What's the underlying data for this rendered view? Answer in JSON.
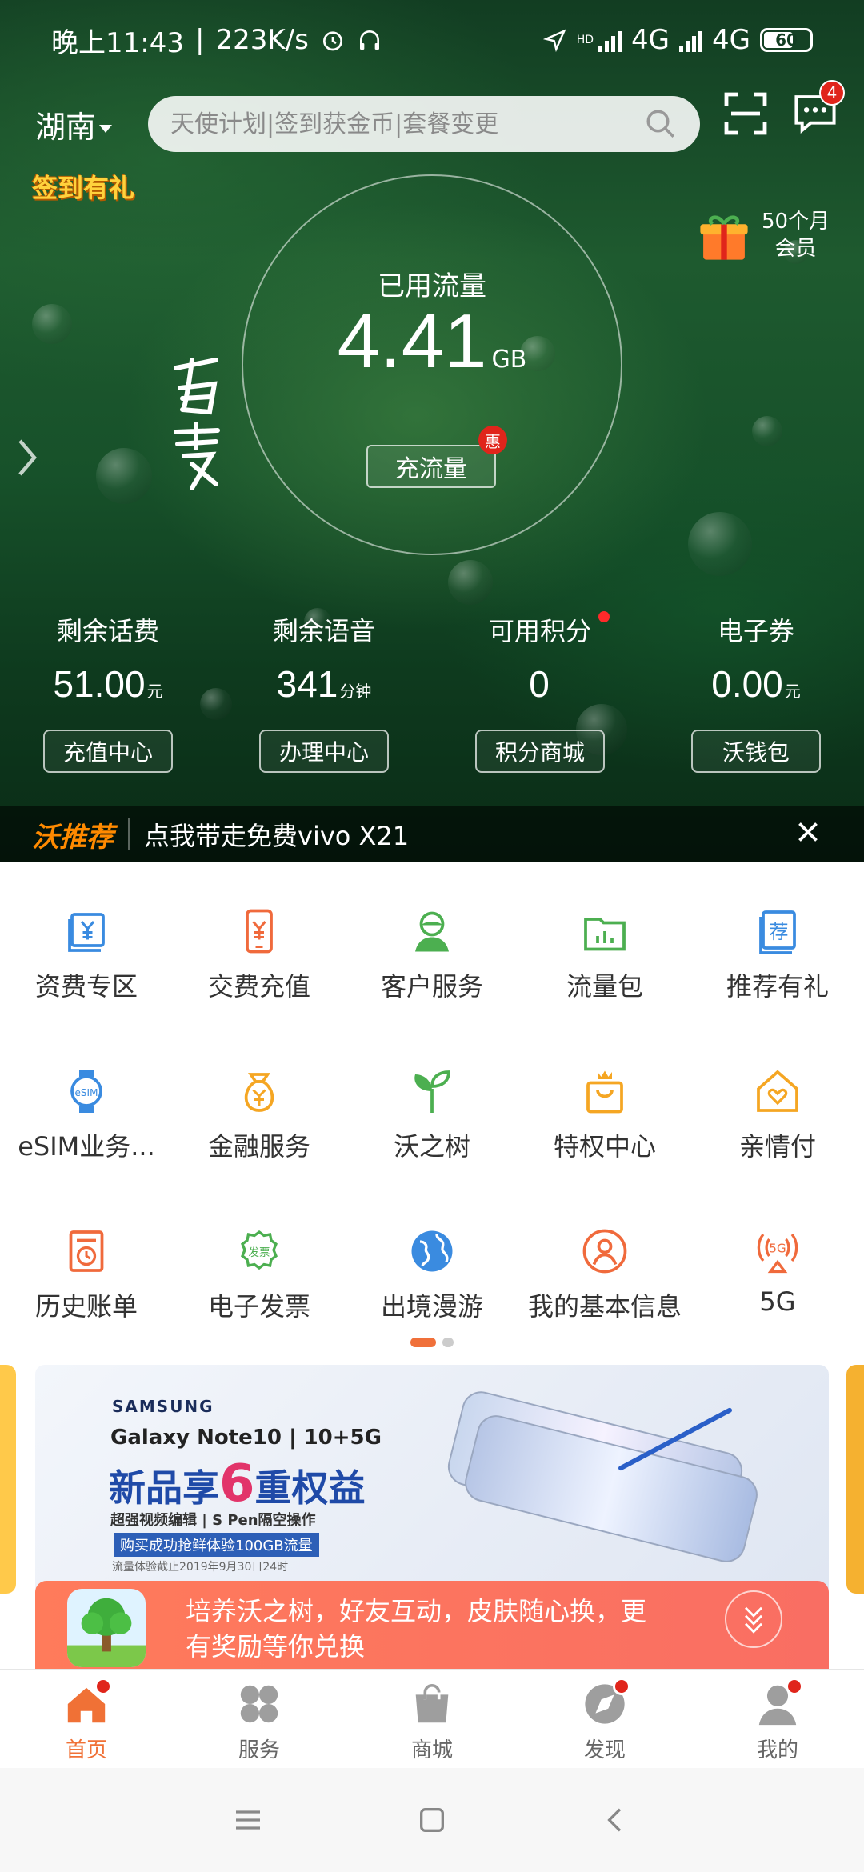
{
  "status_bar": {
    "time": "晚上11:43",
    "speed": "223K/s",
    "network1": "4G",
    "network2": "4G",
    "battery": "60",
    "hd": "HD"
  },
  "header": {
    "region": "湖南",
    "search_placeholder": "天使计划|签到获金币|套餐变更",
    "message_badge": "4"
  },
  "promo_badges": {
    "checkin": "签到有礼",
    "member_line1": "50个月",
    "member_line2": "会员"
  },
  "usage": {
    "label": "已用流量",
    "value": "4.41",
    "unit": "GB",
    "recharge_button": "充流量",
    "hui_badge": "惠"
  },
  "stats": [
    {
      "label": "剩余话费",
      "value": "51.00",
      "unit": "元",
      "button": "充值中心",
      "dot": false
    },
    {
      "label": "剩余语音",
      "value": "341",
      "unit": "分钟",
      "button": "办理中心",
      "dot": false
    },
    {
      "label": "可用积分",
      "value": "0",
      "unit": "",
      "button": "积分商城",
      "dot": true
    },
    {
      "label": "电子券",
      "value": "0.00",
      "unit": "元",
      "button": "沃钱包",
      "dot": false
    }
  ],
  "recommend": {
    "title": "沃推荐",
    "text": "点我带走免费vivo X21"
  },
  "services": [
    {
      "label": "资费专区",
      "icon": "tariff-icon",
      "color": "#3a8be0"
    },
    {
      "label": "交费充值",
      "icon": "phone-pay-icon",
      "color": "#f06a3c"
    },
    {
      "label": "客户服务",
      "icon": "customer-service-icon",
      "color": "#4caf50"
    },
    {
      "label": "流量包",
      "icon": "data-package-icon",
      "color": "#4caf50"
    },
    {
      "label": "推荐有礼",
      "icon": "recommend-icon",
      "color": "#3a8be0"
    },
    {
      "label": "eSIM业务...",
      "icon": "esim-watch-icon",
      "color": "#3a8be0"
    },
    {
      "label": "金融服务",
      "icon": "money-bag-icon",
      "color": "#f5a623"
    },
    {
      "label": "沃之树",
      "icon": "sprout-icon",
      "color": "#4caf50"
    },
    {
      "label": "特权中心",
      "icon": "crown-bag-icon",
      "color": "#f5a623"
    },
    {
      "label": "亲情付",
      "icon": "heart-home-icon",
      "color": "#f5a623"
    },
    {
      "label": "历史账单",
      "icon": "bill-history-icon",
      "color": "#f06a3c"
    },
    {
      "label": "电子发票",
      "icon": "invoice-icon",
      "color": "#4caf50"
    },
    {
      "label": "出境漫游",
      "icon": "globe-icon",
      "color": "#3a8be0"
    },
    {
      "label": "我的基本信息",
      "icon": "profile-icon",
      "color": "#f06a3c"
    },
    {
      "label": "5G",
      "icon": "5g-icon",
      "color": "#f06a3c"
    }
  ],
  "banner": {
    "brand": "SAMSUNG",
    "model": "Galaxy Note10 | 10+5G",
    "headline_pre": "新品享",
    "headline_num": "6",
    "headline_post": "重权益",
    "sub": "超强视频编辑 | S Pen隔空操作",
    "tag": "购买成功抢鲜体验100GB流量",
    "note": "流量体验截止2019年9月30日24时"
  },
  "promo": {
    "text": "培养沃之树，好友互动，皮肤随心换，更有奖励等你兑换"
  },
  "tabs": [
    {
      "label": "首页",
      "icon": "home-icon",
      "dot": true
    },
    {
      "label": "服务",
      "icon": "services-icon",
      "dot": false
    },
    {
      "label": "商城",
      "icon": "shop-bag-icon",
      "dot": false
    },
    {
      "label": "发现",
      "icon": "compass-icon",
      "dot": true
    },
    {
      "label": "我的",
      "icon": "user-icon",
      "dot": true
    }
  ],
  "colors": {
    "accent": "#f07136",
    "badge_red": "#e0251b",
    "recommend_title": "#ff8a00"
  }
}
